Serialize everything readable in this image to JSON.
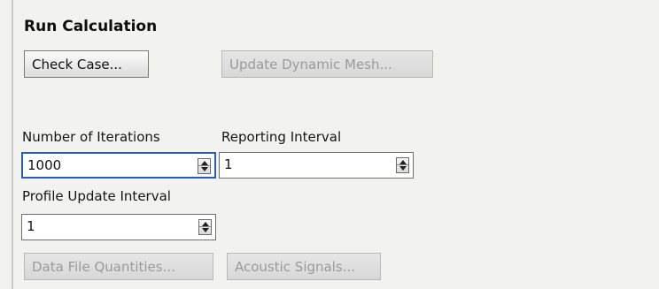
{
  "section": {
    "title": "Run Calculation"
  },
  "buttons": {
    "check_case": "Check Case...",
    "update_dynamic_mesh": "Update Dynamic Mesh...",
    "data_file_quantities": "Data File Quantities...",
    "acoustic_signals": "Acoustic Signals..."
  },
  "fields": {
    "iterations": {
      "label": "Number of Iterations",
      "value": "1000"
    },
    "reporting_interval": {
      "label": "Reporting Interval",
      "value": "1"
    },
    "profile_update_interval": {
      "label": "Profile Update Interval",
      "value": "1"
    }
  },
  "icons": {
    "spinner": "spinner-up-down-icon"
  },
  "colors": {
    "focus_border": "#2e5fa6",
    "disabled_text": "#9a9a9a"
  }
}
